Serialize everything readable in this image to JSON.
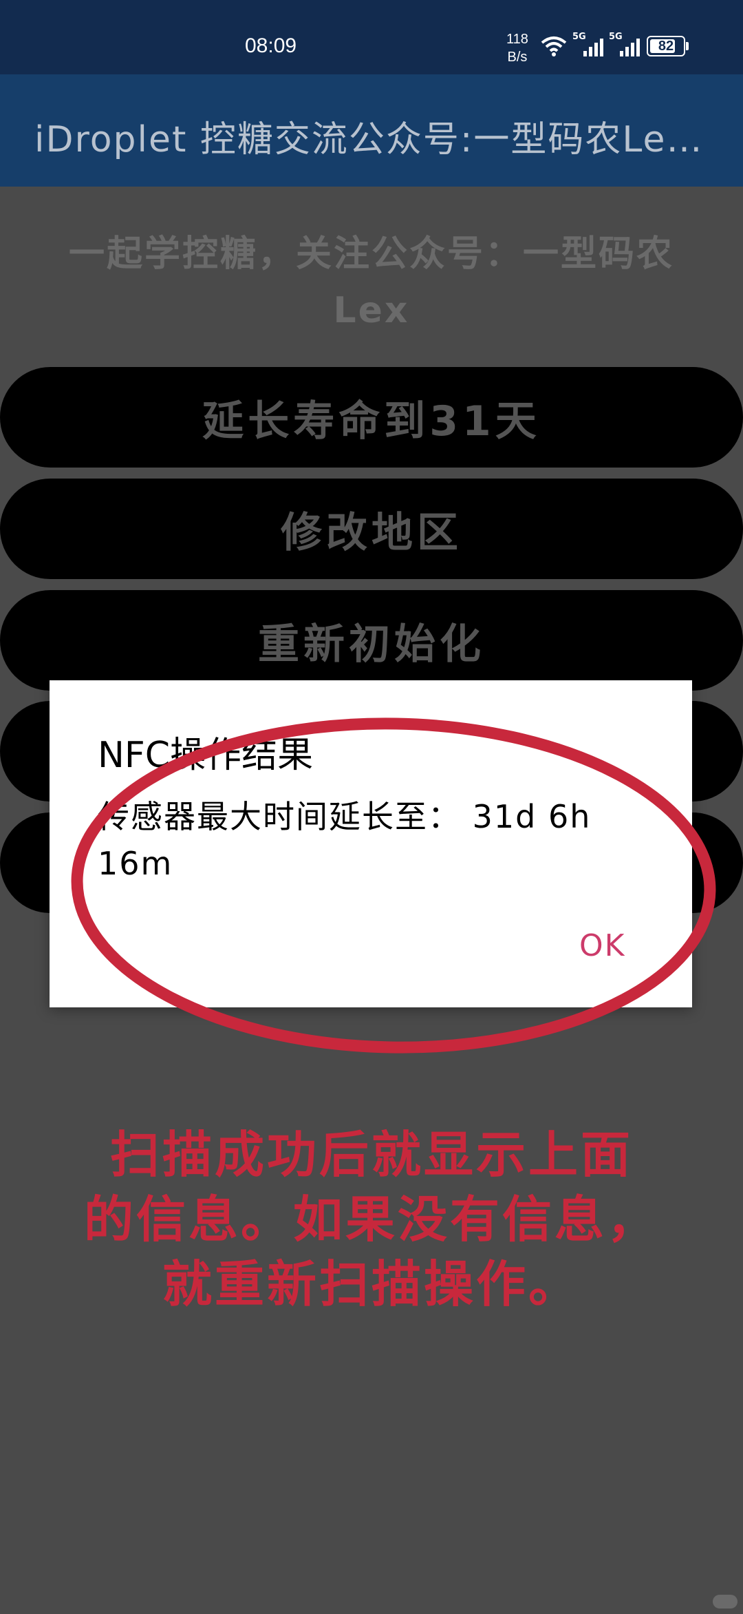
{
  "status_bar": {
    "time": "08:09",
    "net_speed_value": "118",
    "net_speed_unit": "B/s",
    "sim1_label": "5G",
    "sim2_label": "5G",
    "battery": "82",
    "icons": [
      "wifi-icon",
      "signal-icon",
      "signal-icon",
      "battery-icon"
    ]
  },
  "app_bar": {
    "title": "iDroplet 控糖交流公众号:一型码农Le…"
  },
  "subtitle": {
    "line1": "一起学控糖，关注公众号：一型码农",
    "line2": "Lex"
  },
  "buttons": [
    {
      "label": "延长寿命到31天"
    },
    {
      "label": "修改地区"
    },
    {
      "label": "重新初始化"
    },
    {
      "label": ""
    },
    {
      "label": ""
    }
  ],
  "dialog": {
    "title": "NFC操作结果",
    "message": "传感器最大时间延长至： 31d 6h 16m",
    "ok_label": "OK"
  },
  "annotation": {
    "line1": "扫描成功后就显示上面",
    "line2": "的信息。如果没有信息，",
    "line3": "就重新扫描操作。",
    "color": "#c8283c"
  },
  "colors": {
    "status_bar": "#122b4f",
    "app_bar": "#163e6a",
    "background": "#4a4a4a",
    "accent_ok": "#cc3b6a"
  }
}
